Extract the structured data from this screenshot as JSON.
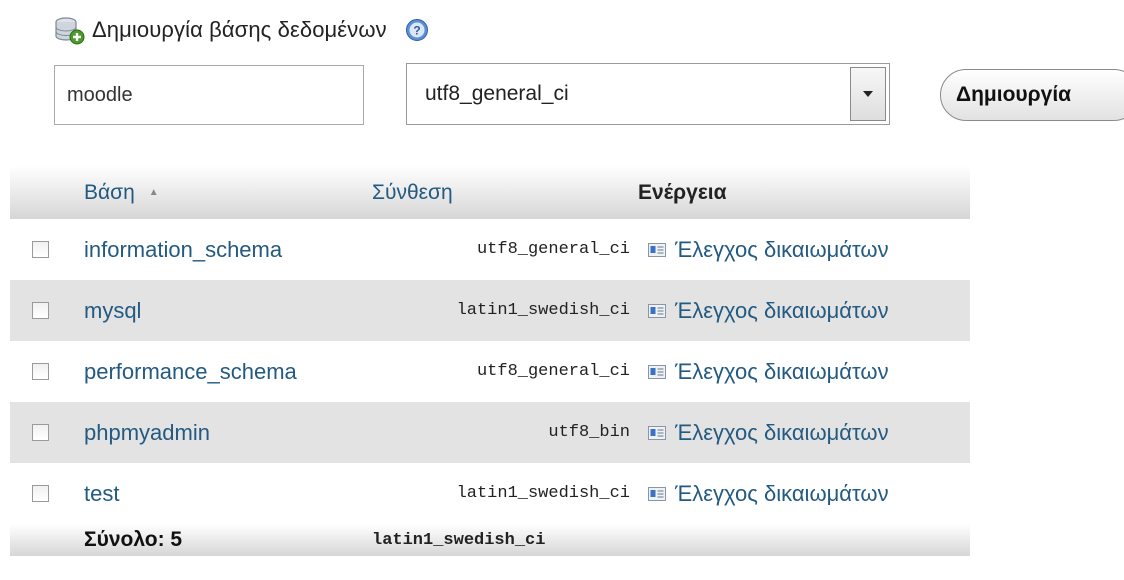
{
  "create_db": {
    "title": "Δημιουργία βάσης δεδομένων",
    "db_icon": "database-add-icon",
    "help_icon": "help-icon",
    "name_value": "moodle",
    "collation_value": "utf8_general_ci",
    "create_label": "Δημιουργία"
  },
  "table": {
    "headers": {
      "database": "Βάση",
      "collation": "Σύνθεση",
      "action": "Ενέργεια"
    },
    "sort_indicator": "▲",
    "rows": [
      {
        "name": "information_schema",
        "collation": "utf8_general_ci",
        "action": "Έλεγχος δικαιωμάτων"
      },
      {
        "name": "mysql",
        "collation": "latin1_swedish_ci",
        "action": "Έλεγχος δικαιωμάτων"
      },
      {
        "name": "performance_schema",
        "collation": "utf8_general_ci",
        "action": "Έλεγχος δικαιωμάτων"
      },
      {
        "name": "phpmyadmin",
        "collation": "utf8_bin",
        "action": "Έλεγχος δικαιωμάτων"
      },
      {
        "name": "test",
        "collation": "latin1_swedish_ci",
        "action": "Έλεγχος δικαιωμάτων"
      }
    ],
    "footer": {
      "total_label": "Σύνολο: 5",
      "collation": "latin1_swedish_ci"
    }
  },
  "colors": {
    "link": "#235a81",
    "row_shade": "#e3e3e3"
  }
}
